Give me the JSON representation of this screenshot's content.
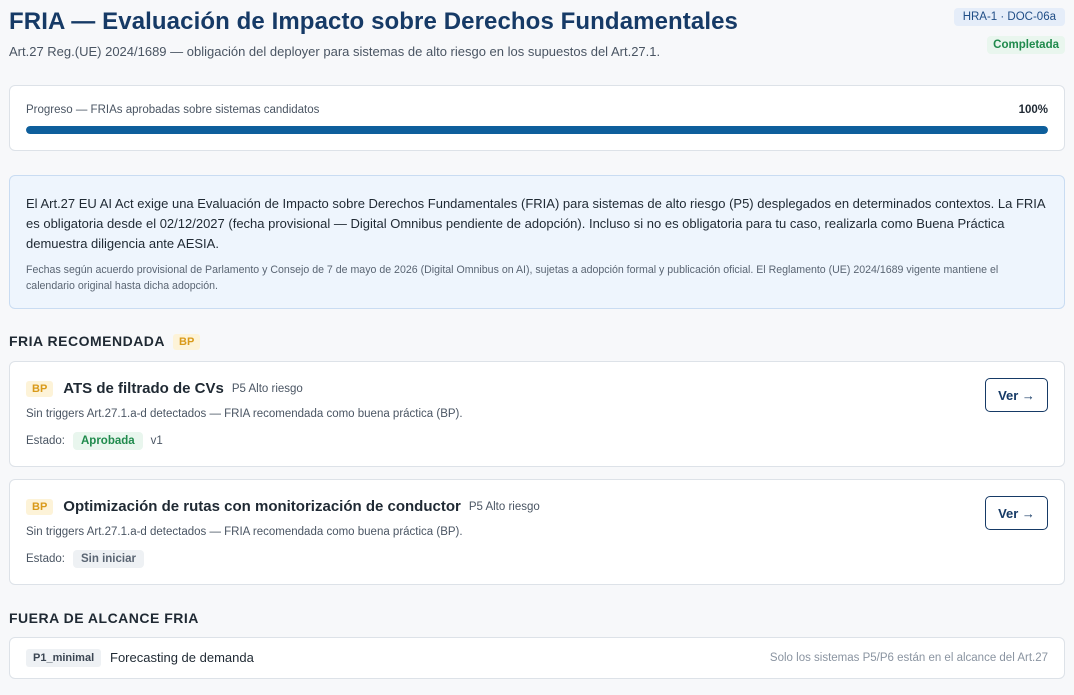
{
  "header": {
    "title": "FRIA — Evaluación de Impacto sobre Derechos Fundamentales",
    "subtitle": "Art.27 Reg.(UE) 2024/1689 — obligación del deployer para sistemas de alto riesgo en los supuestos del Art.27.1.",
    "doc_badge": "HRA-1 · DOC-06a",
    "status": "Completada"
  },
  "progress": {
    "label": "Progreso — FRIAs aprobadas sobre sistemas candidatos",
    "percent_label": "100%",
    "fraction": 1.0
  },
  "info": {
    "main": "El Art.27 EU AI Act exige una Evaluación de Impacto sobre Derechos Fundamentales (FRIA) para sistemas de alto riesgo (P5) desplegados en determinados contextos. La FRIA es obligatoria desde el 02/12/2027 (fecha provisional — Digital Omnibus pendiente de adopción). Incluso si no es obligatoria para tu caso, realizarla como Buena Práctica demuestra diligencia ante AESIA.",
    "note": "Fechas según acuerdo provisional de Parlamento y Consejo de 7 de mayo de 2026 (Digital Omnibus on AI), sujetas a adopción formal y publicación oficial. El Reglamento (UE) 2024/1689 vigente mantiene el calendario original hasta dicha adopción."
  },
  "recommended": {
    "title": "FRIA RECOMENDADA",
    "badge": "BP",
    "items": [
      {
        "badge": "BP",
        "name": "ATS de filtrado de CVs",
        "risk": "P5 Alto riesgo",
        "desc": "Sin triggers Art.27.1.a-d detectados — FRIA recomendada como buena práctica (BP).",
        "state_label": "Estado:",
        "state": "Aprobada",
        "version": "v1",
        "button": "Ver →"
      },
      {
        "badge": "BP",
        "name": "Optimización de rutas con monitorización de conductor",
        "risk": "P5 Alto riesgo",
        "desc": "Sin triggers Art.27.1.a-d detectados — FRIA recomendada como buena práctica (BP).",
        "state_label": "Estado:",
        "state": "Sin iniciar",
        "button": "Ver →"
      }
    ]
  },
  "out_of_scope": {
    "title": "FUERA DE ALCANCE FRIA",
    "items": [
      {
        "tag": "P1_minimal",
        "name": "Forecasting de demanda",
        "note": "Solo los sistemas P5/P6 están en el alcance del Art.27"
      }
    ]
  },
  "colors": {
    "primary": "#163a66",
    "progress": "#0e5f9c",
    "success": "#1f8a4c",
    "bp": "#d99a1a"
  }
}
